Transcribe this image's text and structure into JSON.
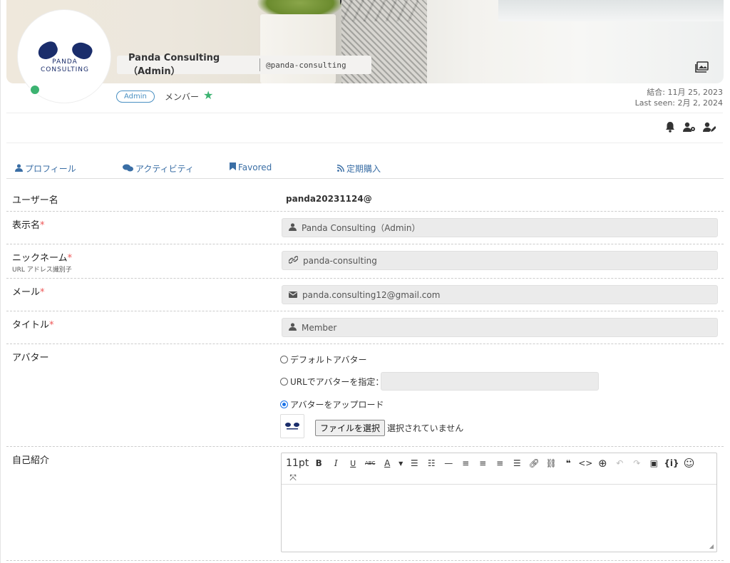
{
  "profile": {
    "name": "Panda Consulting（Admin）",
    "handle": "@panda-consulting",
    "logo_line1": "PANDA",
    "logo_line2": "CONSULTING",
    "role_badge": "Admin",
    "member_label": "メンバー",
    "joined": "結合: 11月 25, 2023",
    "last_seen": "Last seen: 2月 2, 2024",
    "online_color": "#3cb371"
  },
  "header_icons": [
    "notification-bell-icon",
    "user-settings-icon",
    "user-edit-icon"
  ],
  "tabs": [
    {
      "label": "プロフィール",
      "icon": "user-icon"
    },
    {
      "label": "アクティビティ",
      "icon": "comments-icon"
    },
    {
      "label": "Favored",
      "icon": "bookmark-icon"
    },
    {
      "label": "定期購入",
      "icon": "rss-icon"
    }
  ],
  "form": {
    "username": {
      "label": "ユーザー名",
      "value": "panda20231124@"
    },
    "display_name": {
      "label": "表示名",
      "required": "*",
      "value": "Panda Consulting（Admin）"
    },
    "nickname": {
      "label": "ニックネーム",
      "required": "*",
      "hint": "URL アドレス識別子",
      "value": "panda-consulting"
    },
    "email": {
      "label": "メール",
      "required": "*",
      "value": "panda.consulting12@gmail.com"
    },
    "title": {
      "label": "タイトル",
      "required": "*",
      "value": "Member"
    },
    "avatar": {
      "label": "アバター",
      "option_default": "デフォルトアバター",
      "option_url": "URLでアバターを指定：",
      "option_upload": "アバターをアップロード",
      "selected": "upload",
      "file_button": "ファイルを選択",
      "file_status": "選択されていません"
    },
    "bio": {
      "label": "自己紹介",
      "font_size": "11pt"
    }
  },
  "colors": {
    "accent": "#3a6ea5",
    "required": "#e55555",
    "star": "#3cb371"
  }
}
